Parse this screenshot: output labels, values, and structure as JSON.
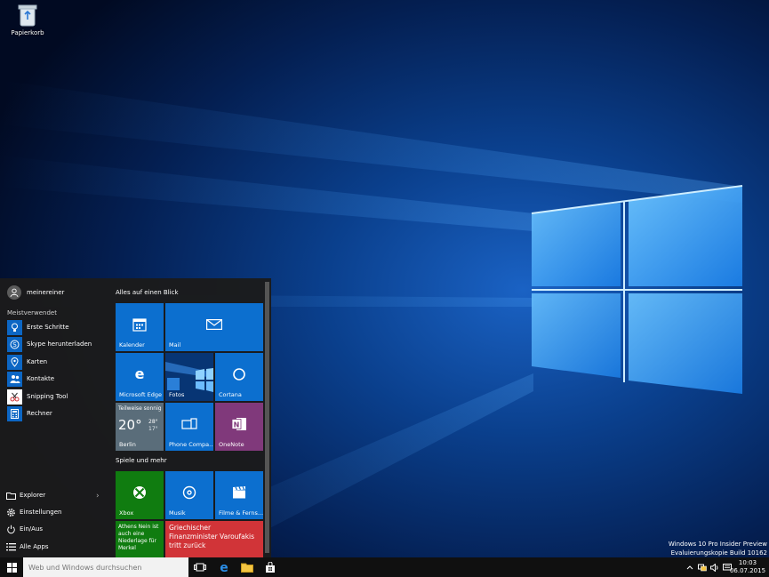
{
  "desktop": {
    "recycle_bin_label": "Papierkorb",
    "watermark_line1": "Windows 10 Pro Insider Preview",
    "watermark_line2": "Evaluierungskopie Build 10162"
  },
  "start_menu": {
    "user_name": "meinereiner",
    "most_used_label": "Meistverwendet",
    "most_used": [
      {
        "label": "Erste Schritte",
        "icon": "lightbulb-icon"
      },
      {
        "label": "Skype herunterladen",
        "icon": "skype-icon"
      },
      {
        "label": "Karten",
        "icon": "map-icon"
      },
      {
        "label": "Kontakte",
        "icon": "people-icon"
      },
      {
        "label": "Snipping Tool",
        "icon": "scissors-icon"
      },
      {
        "label": "Rechner",
        "icon": "calculator-icon"
      }
    ],
    "bottom": {
      "explorer": "Explorer",
      "settings": "Einstellungen",
      "power": "Ein/Aus",
      "all_apps": "Alle Apps"
    },
    "groups": {
      "overview": "Alles auf einen Blick",
      "play": "Spiele und mehr"
    },
    "tiles": {
      "calendar": "Kalender",
      "mail": "Mail",
      "edge": "Microsoft Edge",
      "photos": "Fotos",
      "cortana": "Cortana",
      "weather_condition": "Teilweise sonnig",
      "weather_temp": "20°",
      "weather_high": "28°",
      "weather_low": "17°",
      "weather_city": "Berlin",
      "phone": "Phone Compa...",
      "onenote": "OneNote",
      "xbox": "Xbox",
      "music": "Musik",
      "movies": "Filme & Ferns...",
      "news_small": "Athens Nein ist auch eine Niederlage für Merkel",
      "news_large": "Griechischer Finanzminister Varoufakis tritt zurück"
    },
    "colors": {
      "tile_blue": "#0c6fcf",
      "xbox_green": "#107c10",
      "onenote_purple": "#80397b",
      "news_red": "#d13438",
      "weather_gray": "#5a6d7a"
    }
  },
  "taskbar": {
    "search_placeholder": "Web und Windows durchsuchen",
    "time": "10:03",
    "date": "06.07.2015"
  }
}
